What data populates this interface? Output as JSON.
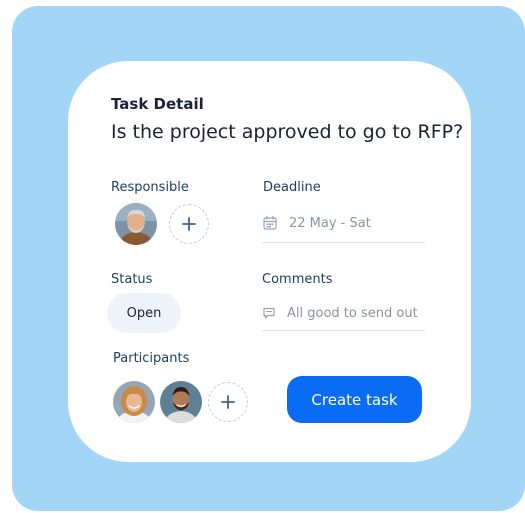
{
  "task": {
    "label": "Task Detail",
    "title": "Is the project approved to go to RFP?"
  },
  "responsible": {
    "label": "Responsible"
  },
  "deadline": {
    "label": "Deadline",
    "value": "22 May - Sat",
    "icon": "calendar-icon"
  },
  "status": {
    "label": "Status",
    "value": "Open"
  },
  "comments": {
    "label": "Comments",
    "value": "All good to send out",
    "icon": "comment-icon"
  },
  "participants": {
    "label": "Participants"
  },
  "actions": {
    "create_label": "Create task"
  },
  "colors": {
    "backdrop": "#a3d6f6",
    "card": "#ffffff",
    "primary": "#0a6cf5",
    "label": "#1f3f63",
    "title": "#1c2135"
  }
}
